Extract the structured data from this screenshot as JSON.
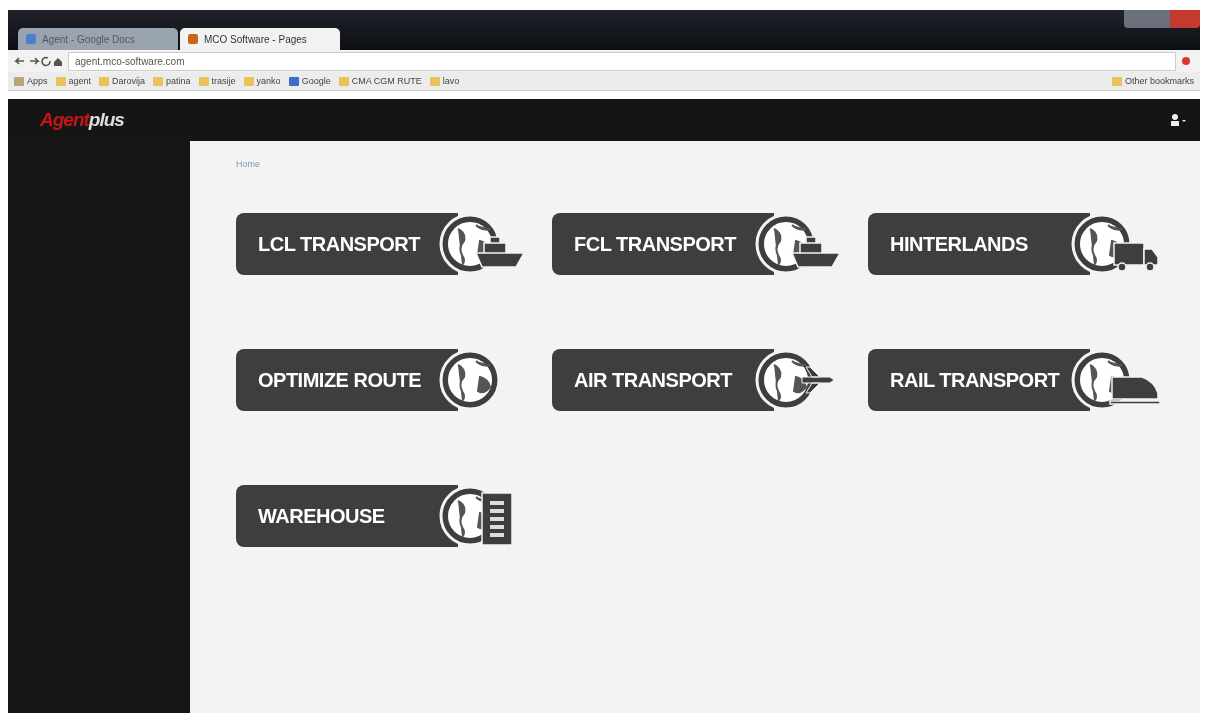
{
  "browser": {
    "tabs": [
      {
        "label": "Agent - Google Docs",
        "selected": false
      },
      {
        "label": "MCO Software - Pages",
        "selected": true
      }
    ],
    "url": "agent.mco-software.com",
    "bookmarks": [
      {
        "label": "Apps",
        "kind": "apps"
      },
      {
        "label": "agent",
        "kind": "folder"
      },
      {
        "label": "Darovija",
        "kind": "folder"
      },
      {
        "label": "patina",
        "kind": "folder"
      },
      {
        "label": "trasije",
        "kind": "folder"
      },
      {
        "label": "yanko",
        "kind": "folder"
      },
      {
        "label": "Google",
        "kind": "site"
      },
      {
        "label": "CMA CGM RUTE",
        "kind": "folder"
      },
      {
        "label": "lavo",
        "kind": "folder"
      }
    ],
    "other_bookmarks": "Other bookmarks"
  },
  "app": {
    "logo": {
      "word1": "Agent",
      "word2": "plus"
    },
    "breadcrumb": "Home",
    "tiles": [
      {
        "label": "LCL TRANSPORT",
        "kind": "ship"
      },
      {
        "label": "FCL TRANSPORT",
        "kind": "ship"
      },
      {
        "label": "HINTERLANDS",
        "kind": "truck"
      },
      {
        "label": "OPTIMIZE ROUTE",
        "kind": "globe"
      },
      {
        "label": "AIR TRANSPORT",
        "kind": "plane"
      },
      {
        "label": "RAIL TRANSPORT",
        "kind": "train"
      },
      {
        "label": "WAREHOUSE",
        "kind": "building"
      }
    ]
  }
}
